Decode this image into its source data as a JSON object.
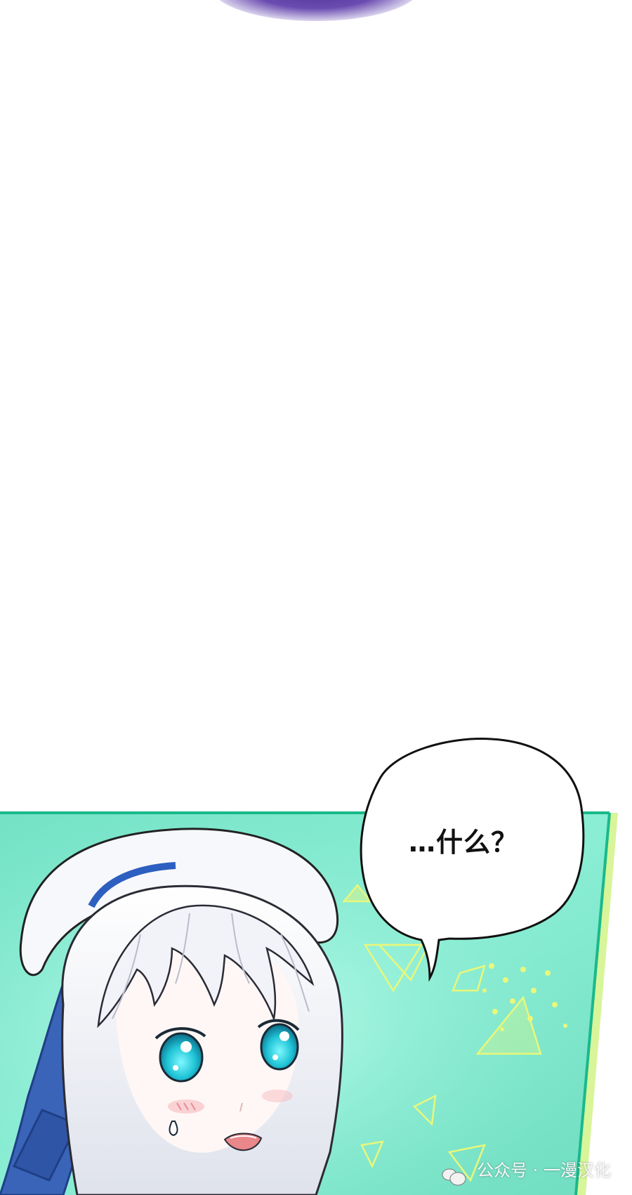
{
  "speech_bubble": {
    "text": "…什么？"
  },
  "watermark": {
    "text": "公众号 · 一漫汉化",
    "icon": "wechat-icon"
  },
  "colors": {
    "panel_bg": "#7ee6cc",
    "panel_border": "#19b98a",
    "side_stripe": "#d8f59a",
    "hair": "#eef0f6",
    "eyes": "#27c6d8",
    "ribbon": "#3a64b8",
    "purple_glow": "#4b2d8f"
  }
}
